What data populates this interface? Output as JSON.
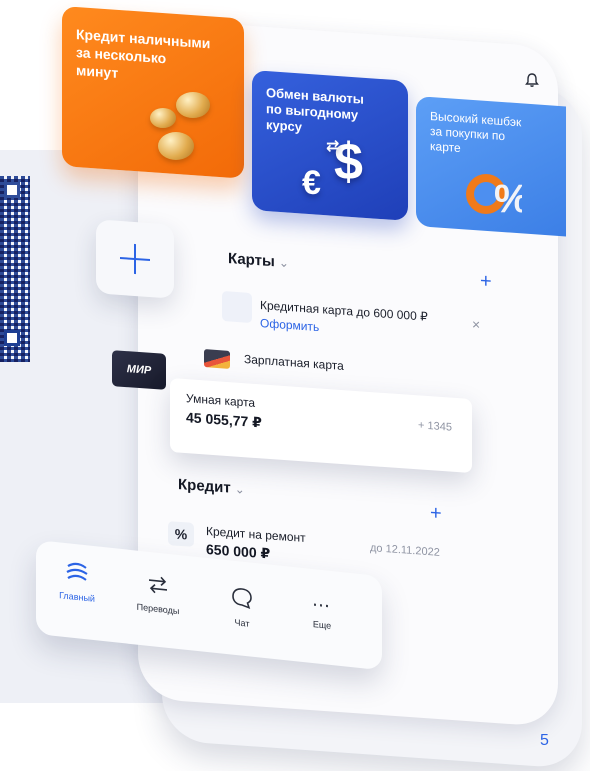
{
  "promos": [
    {
      "title": "Кредит наличными за несколько минут",
      "lines": [
        "Кредит наличными",
        "за несколько",
        "минут"
      ]
    },
    {
      "title": "Обмен валюты по выгодному курсу",
      "lines": [
        "Обмен валюты",
        "по выгодному",
        "курсу"
      ]
    },
    {
      "title": "Высокий кешбэк за покупки по карте",
      "lines": [
        "Высокий кешбэк",
        "за покупки по",
        "карте"
      ]
    }
  ],
  "cards_section": {
    "title": "Карты",
    "offer": {
      "title": "Кредитная карта до 600 000 ₽",
      "action": "Оформить"
    },
    "salary": {
      "title": "Зарплатная карта"
    },
    "smart": {
      "title": "Умная карта",
      "balance": "45 055,77 ₽",
      "change": "+ 1345"
    },
    "mir_label": "МИР"
  },
  "credit_section": {
    "title": "Кредит",
    "item": {
      "title": "Кредит на ремонт",
      "amount": "650 000 ₽",
      "due": "до 12.11.2022"
    }
  },
  "bottom_nav": [
    {
      "label": "Главный",
      "icon": "home-logo-icon",
      "active": true
    },
    {
      "label": "Переводы",
      "icon": "transfer-arrows-icon",
      "active": false
    },
    {
      "label": "Чат",
      "icon": "chat-bubble-icon",
      "active": false
    },
    {
      "label": "Еще",
      "icon": "more-dots-icon",
      "active": false
    }
  ],
  "page_number": "5",
  "colors": {
    "accent": "#2c64e5",
    "orange": "#f26a08",
    "navy": "#1f3fb8"
  }
}
